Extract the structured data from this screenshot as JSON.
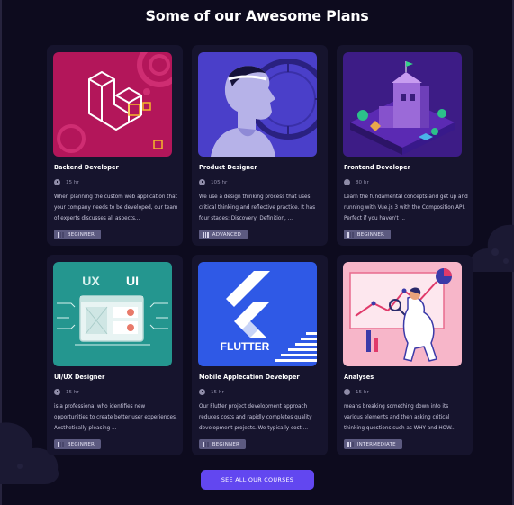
{
  "section": {
    "title": "Some of our Awesome Plans"
  },
  "courses": [
    {
      "title": "Backend Developer",
      "duration": "15 hr",
      "description": "When planning the custom web application that your company needs to be developed, our team of experts discusses all aspects...",
      "level": "BEGINNER",
      "level_value": 1,
      "icon": "clock-icon"
    },
    {
      "title": "Product Designer",
      "duration": "105 hr",
      "description": "We use a design thinking process that uses critical thinking and reflective practice. It has four stages: Discovery, Definition, ...",
      "level": "ADVANCED",
      "level_value": 3,
      "icon": "clock-icon"
    },
    {
      "title": "Frontend Developer",
      "duration": "80 hr",
      "description": "Learn the fundamental concepts and get up and running with Vue.js 3 with the Composition API. Perfect if you haven't ...",
      "level": "BEGINNER",
      "level_value": 1,
      "icon": "clock-icon"
    },
    {
      "title": "UI/UX Designer",
      "duration": "15 hr",
      "description": "is a professional who identifies new opportunities to create better user experiences. Aesthetically pleasing ...",
      "level": "BEGINNER",
      "level_value": 1,
      "icon": "clock-icon",
      "thumb_labels": {
        "left": "UX",
        "right": "UI"
      }
    },
    {
      "title": "Mobile Applecation Developer",
      "duration": "15 hr",
      "description": "Our Flutter project development approach reduces costs and rapidly completes quality development projects. We typically cost ...",
      "level": "BEGINNER",
      "level_value": 1,
      "icon": "clock-icon",
      "thumb_labels": {
        "wordmark": "FLUTTER"
      }
    },
    {
      "title": "Analyses",
      "duration": "15 hr",
      "description": "means breaking something down into its various elements and then asking critical thinking questions such as WHY and HOW...",
      "level": "INTERMEDIATE",
      "level_value": 2,
      "icon": "clock-icon"
    }
  ],
  "cta": {
    "label": "SEE ALL OUR COURSES"
  },
  "colors": {
    "background": "#0d0b1e",
    "card": "#16142d",
    "accent": "#6247f0",
    "badge": "#5c5a80"
  }
}
